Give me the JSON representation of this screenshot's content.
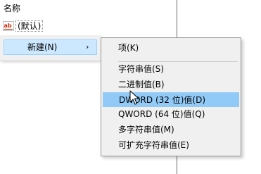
{
  "list": {
    "column_name": "名称",
    "rows": [
      {
        "name": "(默认)",
        "icon": "string-value-icon"
      }
    ]
  },
  "context_menu": {
    "new_item": {
      "label": "新建(N)",
      "arrow": "›"
    }
  },
  "submenu": {
    "items": [
      {
        "label": "项(K)"
      },
      {
        "label": "字符串值(S)"
      },
      {
        "label": "二进制值(B)"
      },
      {
        "label": "DWORD (32 位)值(D)",
        "highlighted": true
      },
      {
        "label": "QWORD (64 位)值(Q)"
      },
      {
        "label": "多字符串值(M)"
      },
      {
        "label": "可扩充字符串值(E)"
      }
    ]
  },
  "colors": {
    "highlight": "#91c9f7",
    "menu_bg": "#f0f0f0",
    "parent_highlight": "#cce8ff"
  }
}
